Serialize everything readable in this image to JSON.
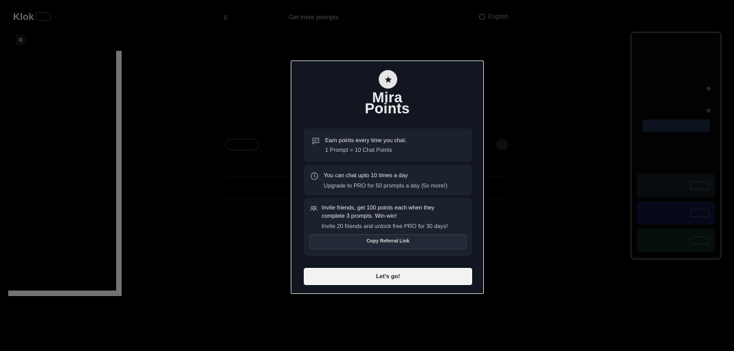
{
  "app": {
    "logo": "Klok"
  },
  "nav": {
    "link_2": "Get more prompts"
  },
  "header": {
    "language": "English"
  },
  "modal": {
    "title_line1": "Mira",
    "title_line2": "Points",
    "card1": {
      "main": "Earn points every time you chat.",
      "sub": "1 Prompt = 10 Chat Points"
    },
    "card2": {
      "main": "You can chat upto 10 times a day",
      "sub": "Upgrade to PRO for 50 prompts a day (5x more!)"
    },
    "card3": {
      "main_line1": "Invite friends, get 100 points each when they",
      "main_line2": "complete 3 prompts. Win-win!",
      "sub": "Invite 20 friends and unlock free PRO for 30 days!",
      "button": "Copy Referral Link"
    },
    "cta": "Let's go!"
  },
  "colors": {
    "modal_bg": "#111620",
    "card_bg": "#1b212d",
    "accent_text": "#b9c3d2",
    "cta_bg": "#f2f2f2",
    "star_badge": "#e6e6e6"
  },
  "icons": [
    "star-icon",
    "chat-bubble-icon",
    "clock-icon",
    "users-icon",
    "globe-icon"
  ]
}
